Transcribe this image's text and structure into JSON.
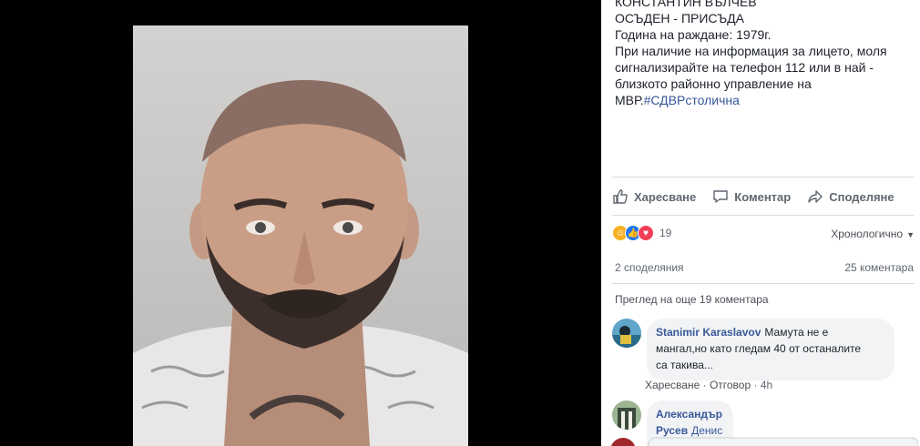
{
  "post": {
    "lines": [
      "КОНСТАНТИН ВЪЛЧЕВ",
      "ОСЪДЕН - ПРИСЪДА",
      "Година на раждане: 1979г.",
      "При наличие на информация за лицето, моля",
      "сигнализирайте на телефон 112 или в най -",
      "близкото районно управление на"
    ],
    "last_line_prefix": "МВР.",
    "hashtag": "#СДВРстолична"
  },
  "actions": {
    "like": "Харесване",
    "comment": "Коментар",
    "share": "Споделяне"
  },
  "reactions": {
    "icons": [
      "haha-icon",
      "like-icon",
      "love-icon"
    ],
    "count": "19"
  },
  "sort": {
    "label": "Хронологично"
  },
  "stats": {
    "shares": "2 споделяния",
    "comments": "25 коментара"
  },
  "more_comments": "Преглед на още 19 коментара",
  "comments": [
    {
      "author": "Stanimir Karaslavov",
      "text_lines": [
        "Мамута не е",
        "мангал,но като гледам 40 от останалите",
        "са такива..."
      ],
      "like": "Харесване",
      "reply": "Отговор",
      "sep": "·",
      "time": "4h"
    },
    {
      "author": "Александър Русев",
      "text_lines": [
        "Денис Буфера"
      ]
    }
  ],
  "colors": {
    "link": "#385898",
    "text": "#1d2129",
    "muted": "#606770",
    "bubble": "#f2f3f5"
  }
}
